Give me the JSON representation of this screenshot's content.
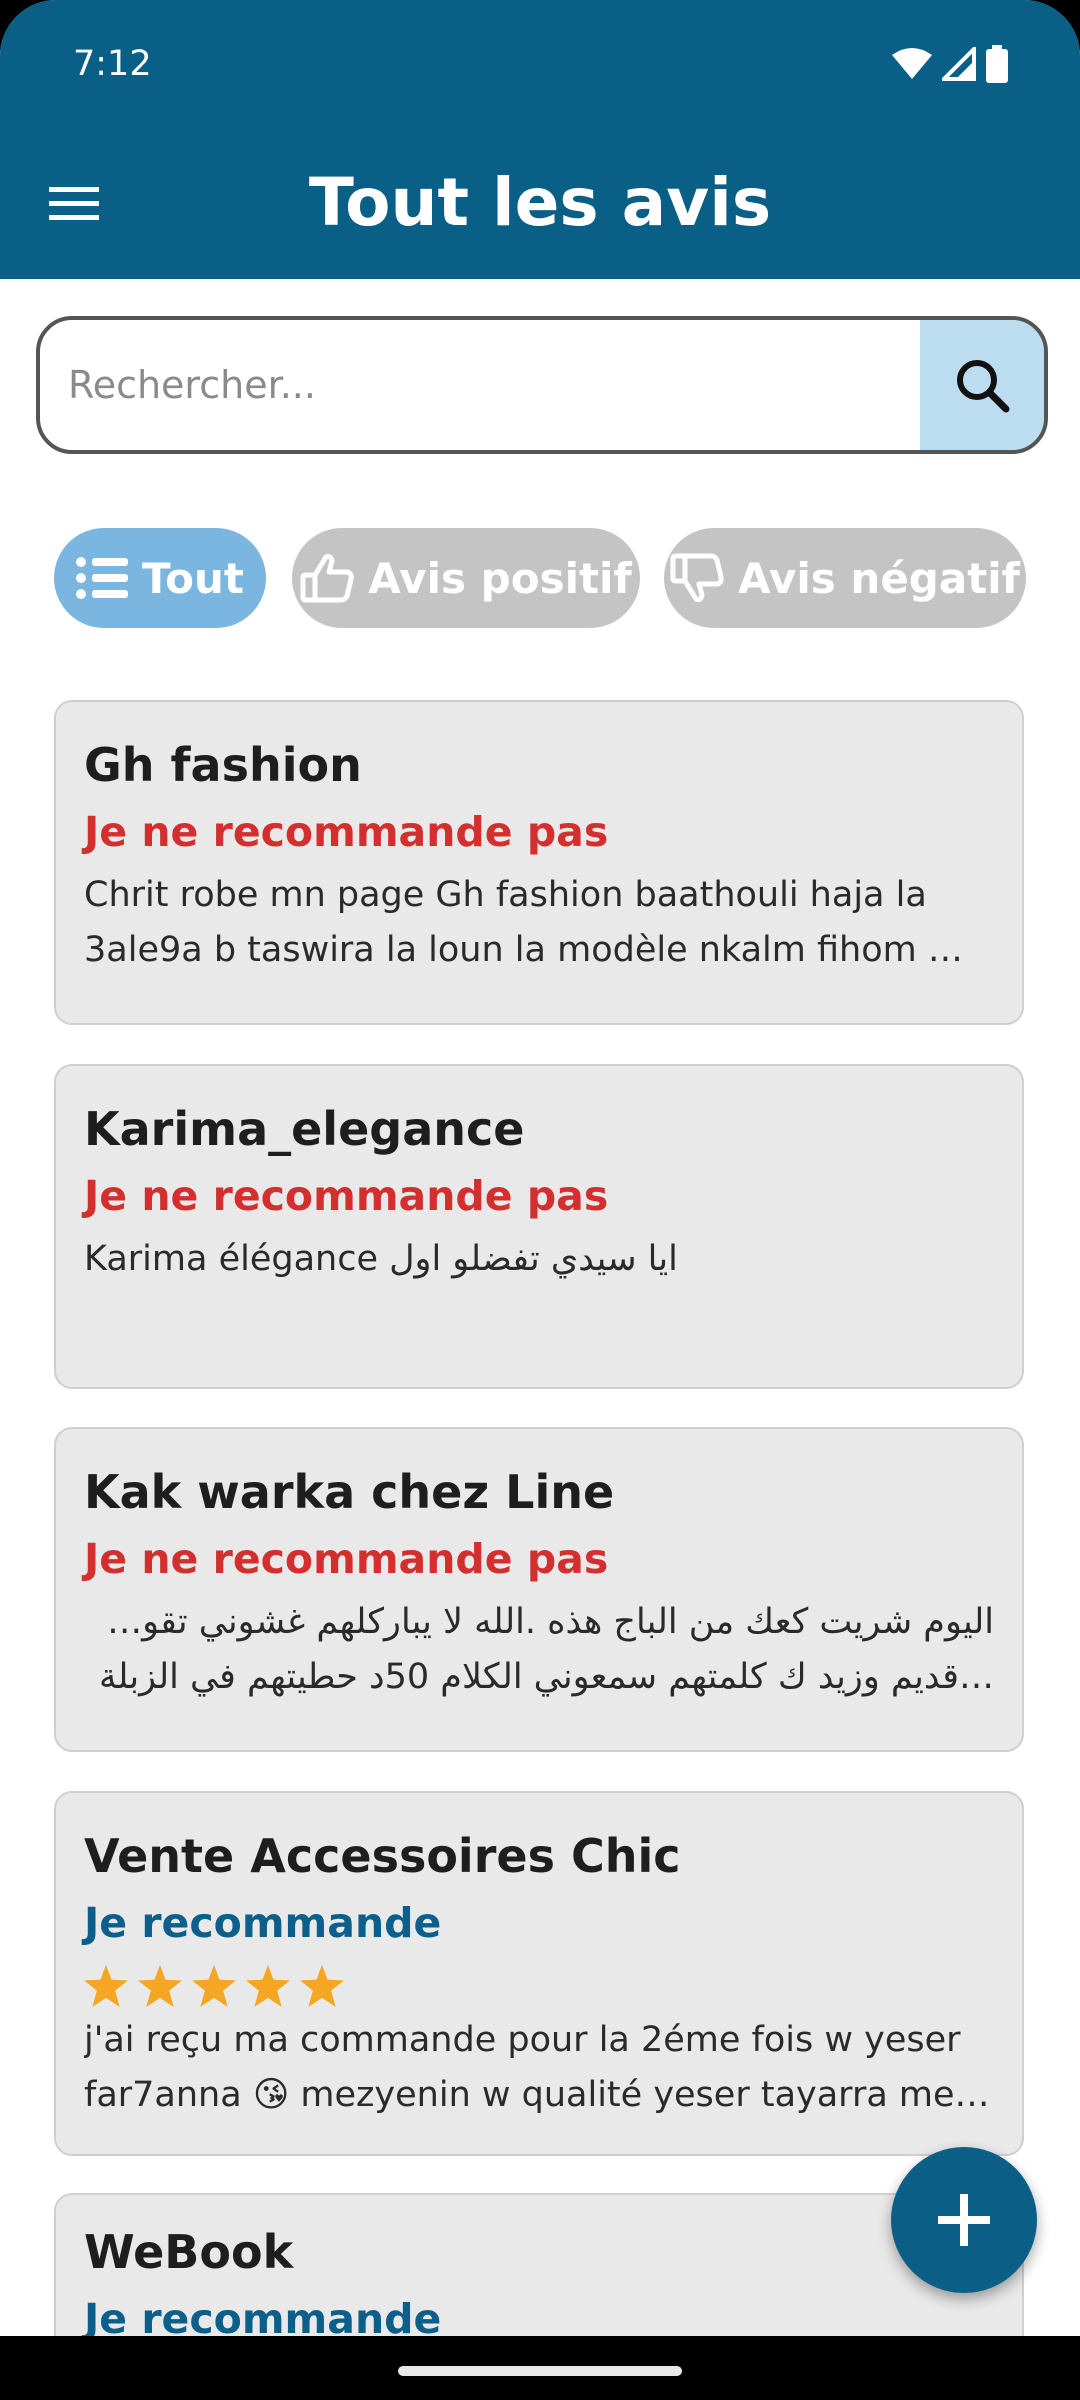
{
  "status_bar": {
    "time": "7:12",
    "icons": [
      "wifi-icon",
      "signal-icon",
      "battery-icon"
    ]
  },
  "app_bar": {
    "title": "Tout les avis",
    "menu_icon": "menu-icon"
  },
  "search": {
    "placeholder": "Rechercher...",
    "value": "",
    "icon": "search-icon"
  },
  "filters": [
    {
      "label": "Tout",
      "icon": "list-icon",
      "active": true
    },
    {
      "label": "Avis positif",
      "icon": "thumbs-up-icon",
      "active": false
    },
    {
      "label": "Avis négatif",
      "icon": "thumbs-down-icon",
      "active": false
    }
  ],
  "reviews": [
    {
      "title": "Gh fashion",
      "verdict": "Je ne recommande pas",
      "positive": false,
      "lines": [
        "Chrit robe mn page  Gh fashion baathouli haja la",
        "3ale9a b taswira la loun la modèle nkalm fihom ml…"
      ]
    },
    {
      "title": "Karima_elegance",
      "verdict": "Je ne recommande pas",
      "positive": false,
      "lines": [
        "Karima élégance ايا سيدي تفضلو اول"
      ]
    },
    {
      "title": "Kak warka chez Line",
      "verdict": "Je ne recommande pas",
      "positive": false,
      "lines": [
        "اليوم شريت كعك من الباج هذه .الله لا يباركلهم غشوني تقول خبز",
        "…قديم وزيد ك كلمتهم سمعوني الكلام  50د حطيتهم في الزبلة"
      ]
    },
    {
      "title": "Vente Accessoires Chic",
      "verdict": "Je recommande",
      "positive": true,
      "rating": 5,
      "lines": [
        "j'ai reçu ma commande pour la 2éme fois w yeser",
        "far7anna 😘 mezyenin w qualité yeser tayarra mer…"
      ]
    },
    {
      "title": "WeBook",
      "verdict": "Je recommande",
      "positive": true,
      "lines": []
    }
  ],
  "fab": {
    "icon": "plus-icon"
  },
  "colors": {
    "primary": "#0a5f87",
    "negative": "#d32f2f",
    "positive": "#0b5f8a",
    "star": "#f5a623",
    "chip_active": "#7bb6e0",
    "chip_inactive": "#c4c4c4"
  }
}
